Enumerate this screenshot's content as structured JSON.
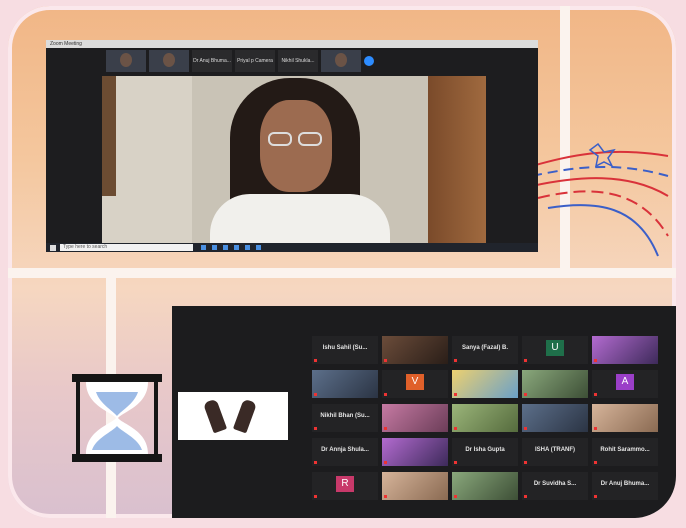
{
  "top_window": {
    "title": "Zoom Meeting",
    "thumbnails": [
      {
        "name": "",
        "kind": "face"
      },
      {
        "name": "",
        "kind": "face"
      },
      {
        "name": "Dr Anuj Bhuma...",
        "kind": "text"
      },
      {
        "name": "Priyal p Camera",
        "kind": "text"
      },
      {
        "name": "Nikhil Shukla...",
        "kind": "text"
      },
      {
        "name": "",
        "kind": "face"
      }
    ],
    "speaker_label": "",
    "taskbar": {
      "search_placeholder": "Type here to search",
      "clock": ""
    }
  },
  "gallery": {
    "tiles": [
      {
        "name": "Ishu Sahil (Su...",
        "style": "text"
      },
      {
        "name": "",
        "style": "pic1"
      },
      {
        "name": "Sanya (Fazal) B.",
        "style": "text"
      },
      {
        "name": "",
        "style": "avatar",
        "letter": "U",
        "color": "#1f6f4a"
      },
      {
        "name": "",
        "style": "pic2"
      },
      {
        "name": "",
        "style": "pic7"
      },
      {
        "name": "",
        "style": "avatar",
        "letter": "V",
        "color": "#e0602a"
      },
      {
        "name": "",
        "style": "pic3"
      },
      {
        "name": "",
        "style": "pic4"
      },
      {
        "name": "",
        "style": "avatar",
        "letter": "A",
        "color": "#9b3fc8"
      },
      {
        "name": "Nikhil Bhan (Su...",
        "style": "text"
      },
      {
        "name": "",
        "style": "pic5"
      },
      {
        "name": "",
        "style": "pic6"
      },
      {
        "name": "",
        "style": "pic7"
      },
      {
        "name": "",
        "style": "pic8"
      },
      {
        "name": "Dr Annja Shula...",
        "style": "text"
      },
      {
        "name": "",
        "style": "pic2"
      },
      {
        "name": "Dr Isha Gupta",
        "style": "text"
      },
      {
        "name": "ISHA (TRANF)",
        "style": "text"
      },
      {
        "name": "Rohit Sarammo...",
        "style": "text"
      },
      {
        "name": "",
        "style": "avatar",
        "letter": "R",
        "color": "#c8396a"
      },
      {
        "name": "",
        "style": "pic8"
      },
      {
        "name": "",
        "style": "pic4"
      },
      {
        "name": "Dr Suvidha S...",
        "style": "text"
      },
      {
        "name": "Dr Anuj Bhuma...",
        "style": "text"
      }
    ]
  },
  "colors": {
    "dark": "#1c1c1e",
    "frame_border": "#fbe8ec",
    "hourglass_sand": "#9dbbe6",
    "ribbon_red": "#d9323a",
    "ribbon_blue": "#3b5fc8"
  }
}
